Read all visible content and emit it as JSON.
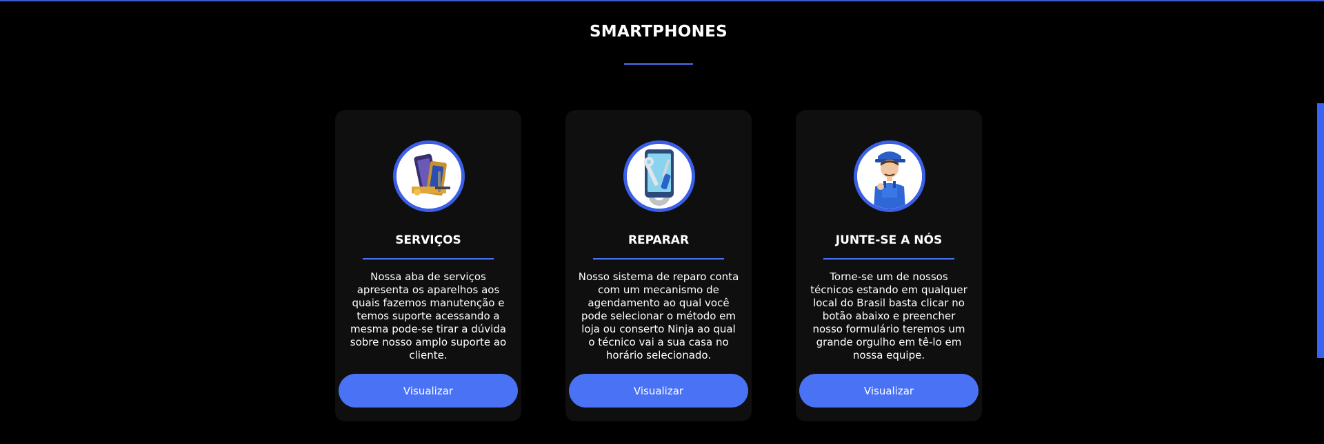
{
  "section": {
    "title": "SMARTPHONES"
  },
  "colors": {
    "accent": "#4a72f5",
    "background": "#000000",
    "card": "#0f0f0f",
    "icon_ring": "#3b5fe6"
  },
  "cards": [
    {
      "icon": "phone-repair-icon",
      "title": "SERVIÇOS",
      "text": "Nossa aba de serviços apresenta os aparelhos aos quais fazemos manutenção e temos suporte acessando a mesma pode-se tirar a dúvida sobre nosso amplo suporte ao cliente.",
      "button": "Visualizar"
    },
    {
      "icon": "tools-smartphone-icon",
      "title": "REPARAR",
      "text": "Nosso sistema de reparo conta com um mecanismo de agendamento ao qual você pode selecionar o método em loja ou conserto Ninja ao qual o técnico vai a sua casa no horário selecionado.",
      "button": "Visualizar"
    },
    {
      "icon": "technician-icon",
      "title": "JUNTE-SE A NÓS",
      "text": "Torne-se um de nossos técnicos estando em qualquer local do Brasil basta clicar no botão abaixo e preencher nosso formulário teremos um grande orgulho em tê-lo em nossa equipe.",
      "button": "Visualizar"
    }
  ]
}
